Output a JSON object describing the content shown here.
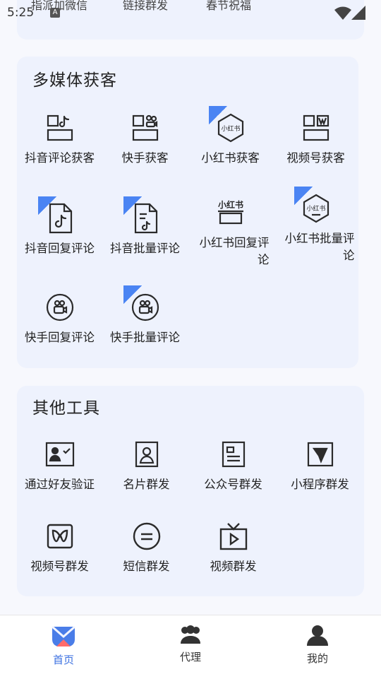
{
  "status_bar": {
    "time": "5:25",
    "notification_icon": "A"
  },
  "prev_section": {
    "labels": [
      "指派加微信",
      "链接群发",
      "春节祝福"
    ]
  },
  "multimedia": {
    "title": "多媒体获客",
    "items": [
      {
        "label": "抖音评论获客",
        "icon": "douyin-grid-icon"
      },
      {
        "label": "快手获客",
        "icon": "kuaishou-grid-icon"
      },
      {
        "label": "小红书获客",
        "icon": "xiaohongshu-badge-icon",
        "ribbon": true
      },
      {
        "label": "视频号获客",
        "icon": "channels-grid-icon"
      },
      {
        "label": "抖音回复评论",
        "icon": "douyin-doc-icon",
        "ribbon": true
      },
      {
        "label": "抖音批量评论",
        "icon": "douyin-batch-doc-icon",
        "ribbon": true
      },
      {
        "label": "小红书回复评论",
        "icon": "xiaohongshu-doc-icon"
      },
      {
        "label": "小红书批量评论",
        "icon": "xiaohongshu-badge-icon",
        "ribbon": true
      },
      {
        "label": "快手回复评论",
        "icon": "kuaishou-circle-icon"
      },
      {
        "label": "快手批量评论",
        "icon": "kuaishou-circle-icon",
        "ribbon": true
      }
    ]
  },
  "tools": {
    "title": "其他工具",
    "items": [
      {
        "label": "通过好友验证",
        "icon": "verify-friend-icon"
      },
      {
        "label": "名片群发",
        "icon": "contact-card-icon"
      },
      {
        "label": "公众号群发",
        "icon": "official-account-icon"
      },
      {
        "label": "小程序群发",
        "icon": "mini-program-icon"
      },
      {
        "label": "视频号群发",
        "icon": "channels-icon"
      },
      {
        "label": "短信群发",
        "icon": "sms-icon"
      },
      {
        "label": "视频群发",
        "icon": "video-icon"
      }
    ]
  },
  "tabbar": {
    "tabs": [
      {
        "label": "首页",
        "active": true
      },
      {
        "label": "代理",
        "active": false
      },
      {
        "label": "我的",
        "active": false
      }
    ]
  },
  "colors": {
    "accent": "#3a6fe0",
    "card_bg": "#eef2fd",
    "icon": "#2b2b2b"
  }
}
